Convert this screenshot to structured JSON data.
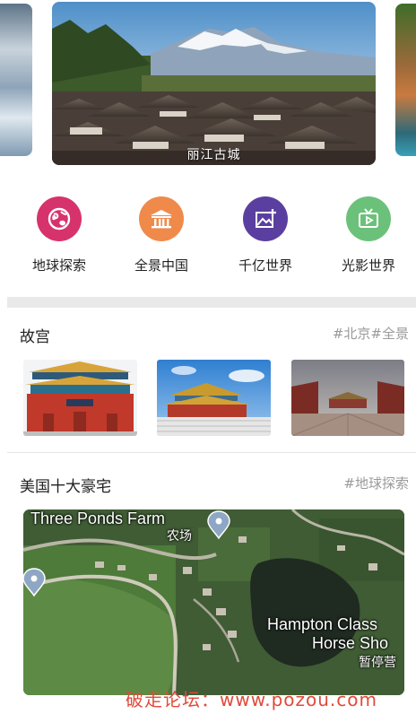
{
  "carousel": {
    "caption": "丽江古城"
  },
  "categories": [
    {
      "label": "地球探索",
      "icon": "globe-icon",
      "color": "#d6336c"
    },
    {
      "label": "全景中国",
      "icon": "temple-icon",
      "color": "#f08a4b"
    },
    {
      "label": "千亿世界",
      "icon": "image-plus-icon",
      "color": "#5b3fa0"
    },
    {
      "label": "光影世界",
      "icon": "tv-icon",
      "color": "#6cc17a"
    }
  ],
  "section1": {
    "title": "故宫",
    "tag": "#北京#全景"
  },
  "section2": {
    "title": "美国十大豪宅",
    "tag": "#地球探索",
    "map": {
      "label_farm": "Three Ponds Farm",
      "label_farm_cn": "农场",
      "label_hampton_1": "Hampton Class",
      "label_hampton_2": "Horse Sho",
      "label_hampton_cn": "暂停营"
    }
  },
  "watermark": "破走论坛：www.pozou.com"
}
